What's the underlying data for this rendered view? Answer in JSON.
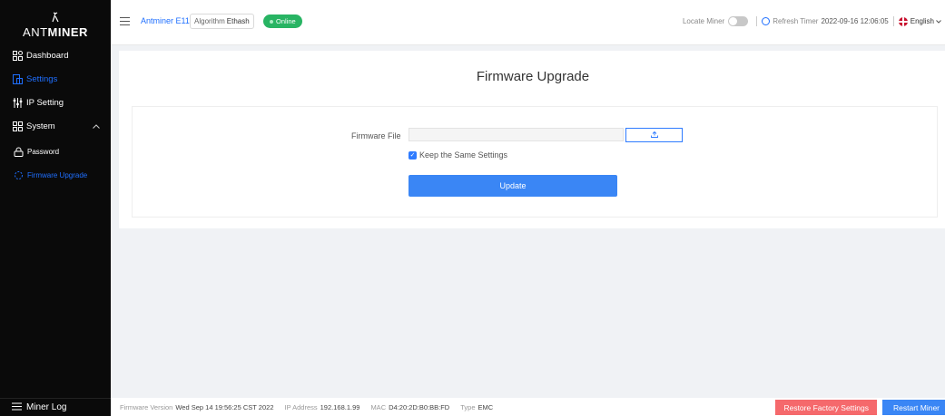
{
  "logo": {
    "prefix": "ANT",
    "suffix": "MINER"
  },
  "sidebar": {
    "items": [
      {
        "label": "Dashboard",
        "icon": "dashboard-icon"
      },
      {
        "label": "Settings",
        "icon": "settings-icon"
      },
      {
        "label": "IP Setting",
        "icon": "ip-setting-icon"
      },
      {
        "label": "System",
        "icon": "system-icon"
      },
      {
        "label": "Password",
        "icon": "lock-icon"
      },
      {
        "label": "Firmware Upgrade",
        "icon": "firmware-icon"
      }
    ],
    "miner_log": "Miner Log"
  },
  "header": {
    "model": "Antminer E11",
    "algorithm_label": "Algorithm",
    "algorithm_value": "Ethash",
    "status": "Online",
    "locate_miner": "Locate Miner",
    "refresh_label": "Refresh Timer",
    "refresh_value": "2022-09-16 12:06:05",
    "language": "English"
  },
  "main": {
    "title": "Firmware Upgrade",
    "firmware_file_label": "Firmware File",
    "keep_settings_label": "Keep the Same Settings",
    "keep_settings_checked": true,
    "update_button": "Update"
  },
  "footer": {
    "firmware_version_label": "Firmware Version",
    "firmware_version": "Wed Sep 14 19:56:25 CST 2022",
    "ip_label": "IP Address",
    "ip": "192.168.1.99",
    "mac_label": "MAC",
    "mac": "D4:20:2D:B0:BB:FD",
    "type_label": "Type",
    "type": "EMC",
    "restore_button": "Restore Factory Settings",
    "restart_button": "Restart Miner"
  },
  "colors": {
    "accent": "#1f6fff",
    "online": "#28b463",
    "danger": "#f5696c",
    "sidebar_bg": "#0a0a0a"
  }
}
